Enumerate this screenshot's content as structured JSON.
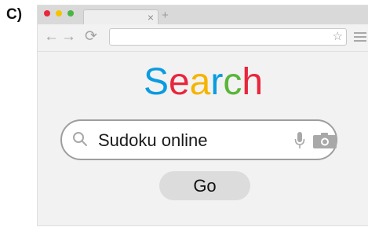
{
  "panel_label": "C)",
  "browser": {
    "tab_close": "×",
    "new_tab": "+",
    "nav": {
      "back": "←",
      "forward": "→",
      "reload": "⟳"
    },
    "address_value": "",
    "bookmark": "☆"
  },
  "page": {
    "logo_letters": [
      "S",
      "e",
      "a",
      "r",
      "c",
      "h"
    ],
    "logo_colors": [
      "#0a9be0",
      "#e8263c",
      "#f5b400",
      "#0a9be0",
      "#5ab53b",
      "#e8263c"
    ],
    "search_value": "Sudoku online",
    "go_label": "Go"
  },
  "icons": {
    "search": "magnifier-icon",
    "mic": "microphone-icon",
    "camera": "camera-icon",
    "menu": "hamburger-menu-icon"
  }
}
